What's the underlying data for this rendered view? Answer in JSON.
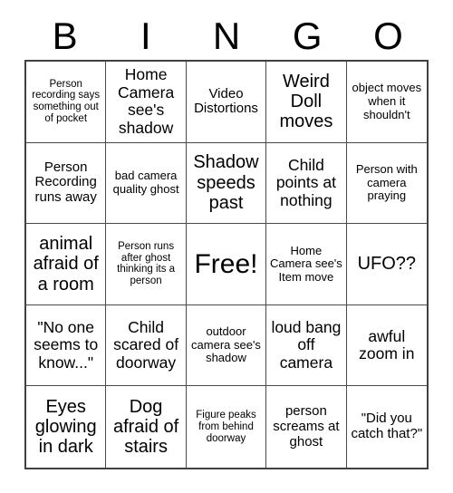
{
  "card": {
    "title": "BINGO",
    "header_letters": [
      "B",
      "I",
      "N",
      "G",
      "O"
    ],
    "free_space_label": "Free!",
    "grid_size": "5x5",
    "colors": {
      "background": "#ffffff",
      "text": "#000000",
      "grid_line": "#4a4a4a",
      "grid_outer_border": "#404040"
    },
    "rows": [
      [
        {
          "text": "Person recording says something out of pocket",
          "size": "xs"
        },
        {
          "text": "Home Camera see's shadow",
          "size": "lg"
        },
        {
          "text": "Video Distortions",
          "size": "md"
        },
        {
          "text": "Weird Doll moves",
          "size": "xl"
        },
        {
          "text": "object moves when it shouldn't",
          "size": "sm"
        }
      ],
      [
        {
          "text": "Person Recording runs away",
          "size": "md"
        },
        {
          "text": "bad camera quality ghost",
          "size": "sm"
        },
        {
          "text": "Shadow speeds past",
          "size": "xl"
        },
        {
          "text": "Child points at nothing",
          "size": "lg"
        },
        {
          "text": "Person with camera praying",
          "size": "sm"
        }
      ],
      [
        {
          "text": "animal afraid of a room",
          "size": "xl"
        },
        {
          "text": "Person runs after ghost thinking its a person",
          "size": "xs"
        },
        {
          "text": "Free!",
          "size": "free"
        },
        {
          "text": "Home Camera see's Item move",
          "size": "sm"
        },
        {
          "text": "UFO??",
          "size": "xl"
        }
      ],
      [
        {
          "text": "\"No one seems to know...\"",
          "size": "lg"
        },
        {
          "text": "Child scared of doorway",
          "size": "lg"
        },
        {
          "text": "outdoor camera see's shadow",
          "size": "sm"
        },
        {
          "text": "loud bang off camera",
          "size": "lg"
        },
        {
          "text": "awful zoom in",
          "size": "lg"
        }
      ],
      [
        {
          "text": "Eyes glowing in dark",
          "size": "xl"
        },
        {
          "text": "Dog afraid of stairs",
          "size": "xl"
        },
        {
          "text": "Figure peaks from behind doorway",
          "size": "xs"
        },
        {
          "text": "person screams at ghost",
          "size": "md"
        },
        {
          "text": "\"Did you catch that?\"",
          "size": "md"
        }
      ]
    ]
  }
}
